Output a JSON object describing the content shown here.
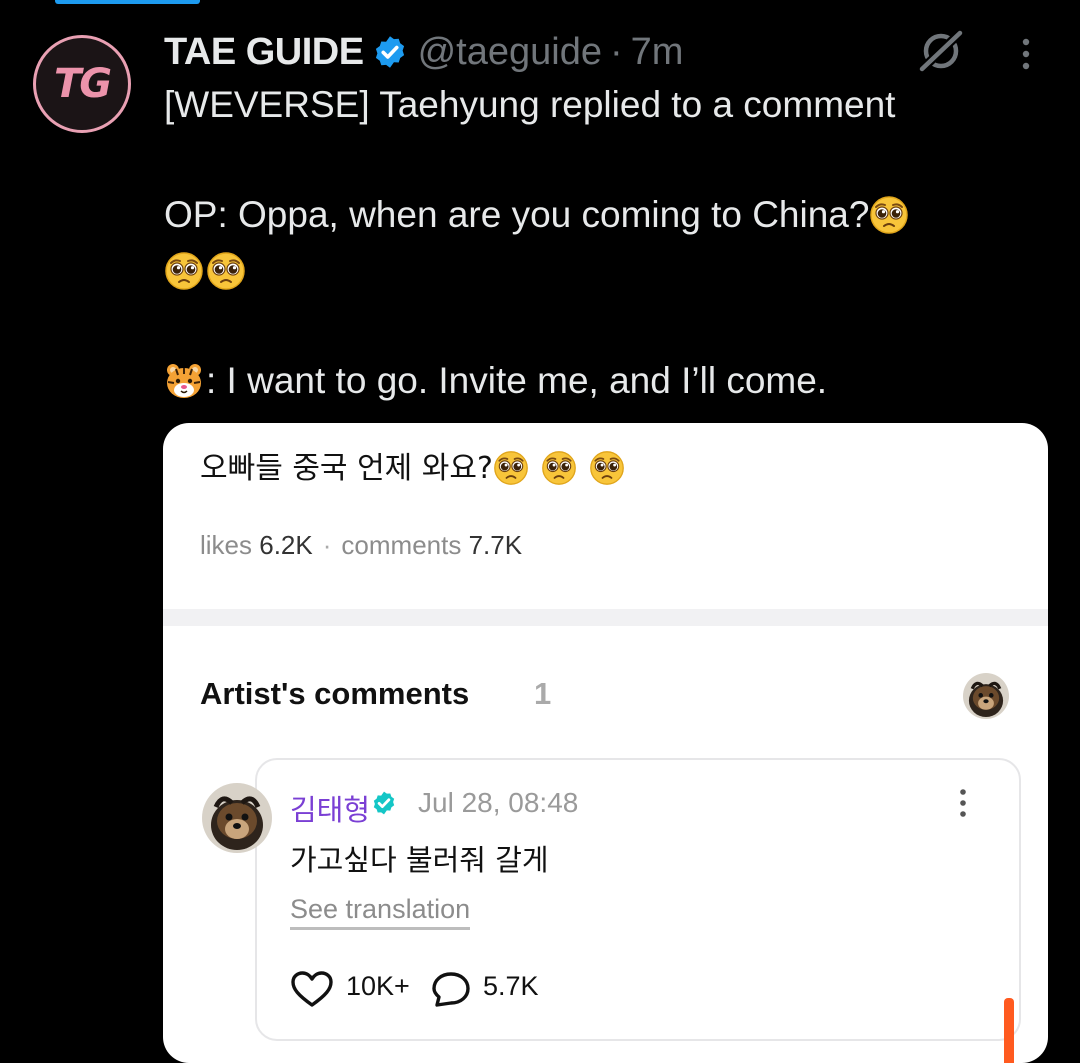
{
  "tweet": {
    "author_name": "TAE GUIDE",
    "avatar_text": "TG",
    "handle": "@taeguide",
    "separator": "·",
    "time": "7m",
    "line1": "[WEVERSE] Taehyung replied to a comment",
    "op_text": "OP: Oppa, when are you coming to China?",
    "reply_text": ": I want to go. Invite me, and I’ll come."
  },
  "embed": {
    "post_text": "오빠들 중국 언제 와요?",
    "likes_label": "likes",
    "likes_value": "6.2K",
    "stats_separator": "·",
    "comments_label": "comments",
    "comments_value": "7.7K",
    "artist_comments_title": "Artist's comments",
    "artist_comments_count": "1",
    "comment": {
      "author": "김태형",
      "date": "Jul 28, 08:48",
      "text": "가고싶다 불러줘 갈게",
      "see_translation": "See translation",
      "likes": "10K+",
      "comments": "5.7K"
    }
  },
  "colors": {
    "background": "#000000",
    "verified_blue": "#1d9bf0",
    "avatar_pink": "#ec93ab",
    "weverse_name": "#7a3fd4",
    "weverse_badge": "#14c6c6",
    "accent_orange": "#ff5a1f"
  },
  "icons": [
    "verified-badge-icon",
    "grok-icon",
    "more-vertical-icon",
    "pleading-face-emoji",
    "tiger-face-emoji",
    "heart-icon",
    "comment-bubble-icon"
  ]
}
